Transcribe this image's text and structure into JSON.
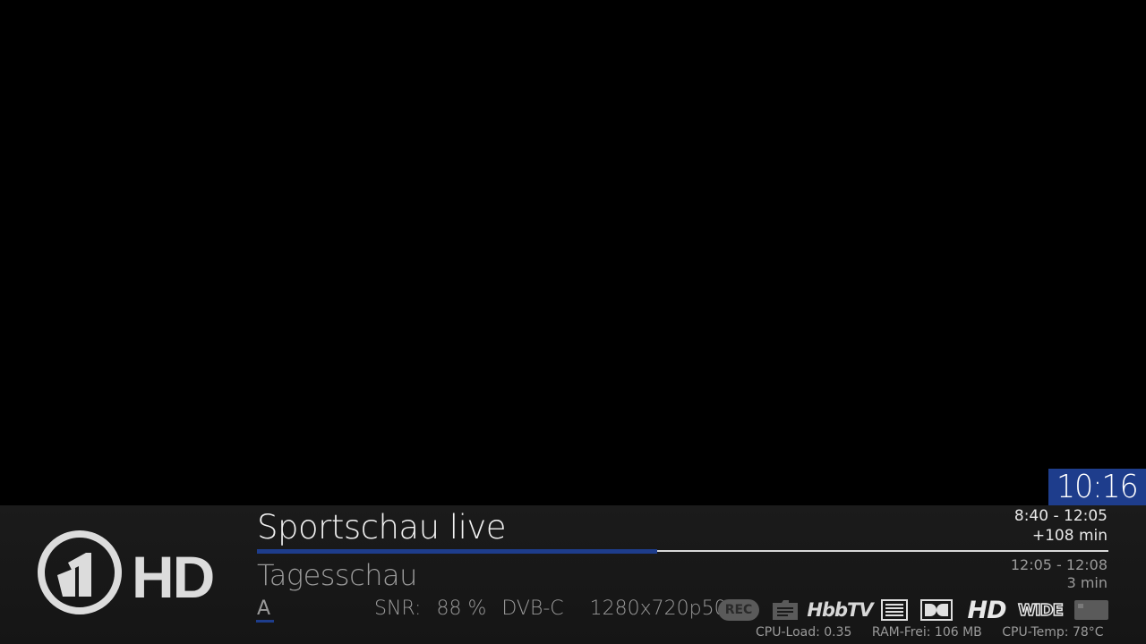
{
  "clock": "10:16",
  "channel": {
    "logo_label": "HD"
  },
  "now": {
    "title": "Sportschau live",
    "time": "8:40  -  12:05",
    "remaining": "+108 min",
    "progress_percent": 47
  },
  "next": {
    "title": "Tagesschau",
    "time": "12:05  -  12:08",
    "remaining": "3 min"
  },
  "audio": {
    "track": "A"
  },
  "signal": {
    "snr_label": "SNR:",
    "snr_value": "88 %",
    "tuner": "DVB-C",
    "resolution": "1280x720p50"
  },
  "status_icons": {
    "rec": "REC",
    "hbbtv": "HbbTV",
    "hd": "HD",
    "wide": "WIDE",
    "names": [
      "rec-icon",
      "epg-icon",
      "hbbtv-icon",
      "teletext-icon",
      "dolby-icon",
      "hd-icon",
      "wide-icon",
      "ci-card-icon"
    ]
  },
  "system": {
    "cpu_load": "CPU-Load: 0.35",
    "ram_free": "RAM-Frei: 106 MB",
    "cpu_temp": "CPU-Temp: 78°C"
  },
  "colors": {
    "accent": "#1e3d8c",
    "bar_bg": "#1b1b1b",
    "text_primary": "#f2f2f2",
    "text_secondary": "#9a9a9a"
  }
}
